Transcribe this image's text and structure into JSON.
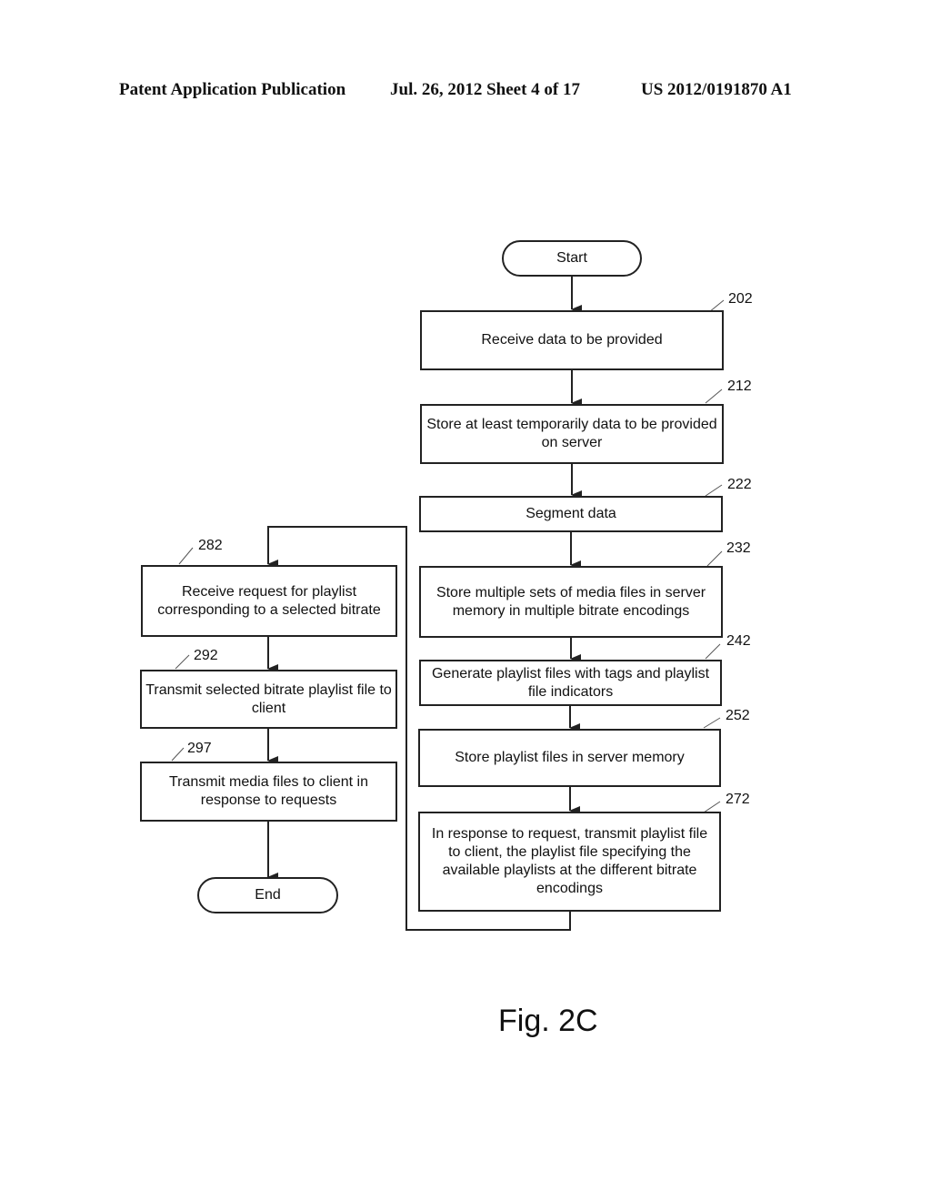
{
  "header": {
    "publication": "Patent Application Publication",
    "date_sheet": "Jul. 26, 2012   Sheet 4 of 17",
    "number": "US 2012/0191870 A1"
  },
  "flowchart": {
    "start": "Start",
    "end": "End",
    "steps": {
      "s202": {
        "ref": "202",
        "text": "Receive data to be provided"
      },
      "s212": {
        "ref": "212",
        "text": "Store at least temporarily data to be provided on server"
      },
      "s222": {
        "ref": "222",
        "text": "Segment data"
      },
      "s232": {
        "ref": "232",
        "text": "Store multiple sets of media files in server memory in multiple bitrate encodings"
      },
      "s242": {
        "ref": "242",
        "text": "Generate playlist files with tags and playlist file indicators"
      },
      "s252": {
        "ref": "252",
        "text": "Store playlist files in server memory"
      },
      "s272": {
        "ref": "272",
        "text": "In response to request, transmit playlist file to client, the playlist file specifying the available playlists at the different bitrate encodings"
      },
      "s282": {
        "ref": "282",
        "text": "Receive request for playlist corresponding to a selected bitrate"
      },
      "s292": {
        "ref": "292",
        "text": "Transmit selected bitrate playlist file to client"
      },
      "s297": {
        "ref": "297",
        "text": "Transmit media files to client in response to requests"
      }
    },
    "edges": [
      [
        "start",
        "s202"
      ],
      [
        "s202",
        "s212"
      ],
      [
        "s212",
        "s222"
      ],
      [
        "s222",
        "s232"
      ],
      [
        "s232",
        "s242"
      ],
      [
        "s242",
        "s252"
      ],
      [
        "s252",
        "s272"
      ],
      [
        "s272",
        "s282"
      ],
      [
        "s282",
        "s292"
      ],
      [
        "s292",
        "s297"
      ],
      [
        "s297",
        "end"
      ]
    ]
  },
  "figure_label": "Fig. 2C"
}
